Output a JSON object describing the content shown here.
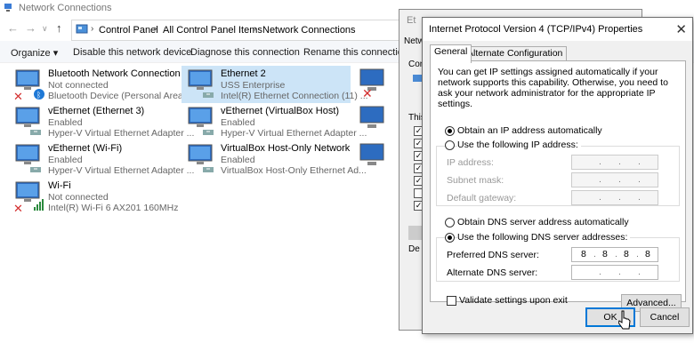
{
  "window": {
    "title": "Network Connections"
  },
  "address_bar": {
    "crumbs": [
      "Control Panel",
      "All Control Panel Items",
      "Network Connections"
    ]
  },
  "commands": [
    "Organize ▾",
    "Disable this network device",
    "Diagnose this connection",
    "Rename this connection"
  ],
  "connections": [
    {
      "name": "Bluetooth Network Connection",
      "status": "Not connected",
      "device": "Bluetooth Device (Personal Area ...",
      "badge": "bluetooth",
      "error": true,
      "selected": false
    },
    {
      "name": "Ethernet 2",
      "status": "USS Enterprise",
      "device": "Intel(R) Ethernet Connection (11) ...",
      "badge": "cable",
      "error": false,
      "selected": true
    },
    {
      "name": "vEthernet (Ethernet 3)",
      "status": "Enabled",
      "device": "Hyper-V Virtual Ethernet Adapter ...",
      "badge": "cable",
      "error": false,
      "selected": false
    },
    {
      "name": "vEthernet (VirtualBox Host)",
      "status": "Enabled",
      "device": "Hyper-V Virtual Ethernet Adapter ...",
      "badge": "cable",
      "error": false,
      "selected": false
    },
    {
      "name": "vEthernet (Wi-Fi)",
      "status": "Enabled",
      "device": "Hyper-V Virtual Ethernet Adapter ...",
      "badge": "cable",
      "error": false,
      "selected": false
    },
    {
      "name": "VirtualBox Host-Only Network",
      "status": "Enabled",
      "device": "VirtualBox Host-Only Ethernet Ad...",
      "badge": "cable",
      "error": false,
      "selected": false
    },
    {
      "name": "Wi-Fi",
      "status": "Not connected",
      "device": "Intel(R) Wi-Fi 6 AX201 160MHz",
      "badge": "wifi",
      "error": true,
      "selected": false
    }
  ],
  "bg_dialog": {
    "title": "Et",
    "tab": "Netw",
    "connect": "Conn",
    "items_label": "This",
    "desc": "De"
  },
  "dialog": {
    "title": "Internet Protocol Version 4 (TCP/IPv4) Properties",
    "close_glyph": "✕",
    "tabs": [
      "General",
      "Alternate Configuration"
    ],
    "info": "You can get IP settings assigned automatically if your network supports this capability. Otherwise, you need to ask your network administrator for the appropriate IP settings.",
    "ip_auto": "Obtain an IP address automatically",
    "ip_manual": "Use the following IP address:",
    "ip_fields": [
      "IP address:",
      "Subnet mask:",
      "Default gateway:"
    ],
    "dns_auto": "Obtain DNS server address automatically",
    "dns_manual": "Use the following DNS server addresses:",
    "preferred_label": "Preferred DNS server:",
    "preferred_value": [
      "8",
      "8",
      "8",
      "8"
    ],
    "alternate_label": "Alternate DNS server:",
    "validate": "Validate settings upon exit",
    "advanced": "Advanced...",
    "ok": "OK",
    "cancel": "Cancel"
  }
}
